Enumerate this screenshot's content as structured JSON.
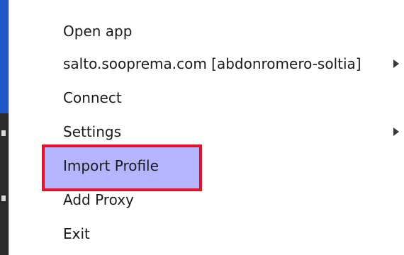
{
  "menu": {
    "items": [
      {
        "label": "Open app",
        "has_submenu": false
      },
      {
        "label": "salto.sooprema.com [abdonromero-soltia]",
        "has_submenu": true
      },
      {
        "label": "Connect",
        "has_submenu": false
      },
      {
        "label": "Settings",
        "has_submenu": true
      },
      {
        "label": "Import Profile",
        "has_submenu": false,
        "highlighted": true
      },
      {
        "label": "Add Proxy",
        "has_submenu": false
      },
      {
        "label": "Exit",
        "has_submenu": false
      }
    ],
    "arrow_icon": "chevron-right-icon"
  },
  "colors": {
    "highlight_fill": "#b5b5ff",
    "highlight_border": "#e4112b",
    "text": "#1a1a1a"
  }
}
